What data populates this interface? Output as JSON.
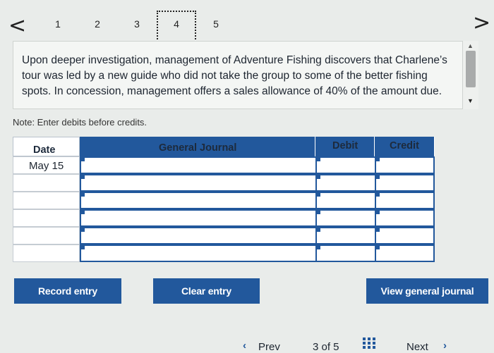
{
  "step_nav": {
    "prev_arrow": "<",
    "next_arrow": ">",
    "steps": [
      "1",
      "2",
      "3",
      "4",
      "5"
    ],
    "current_step": "4"
  },
  "question": {
    "text": "Upon deeper investigation, management of Adventure Fishing discovers that Charlene’s tour was led by a new guide who did not take the group to some of the better fishing spots. In concession, management offers a sales allowance of 40% of the amount due."
  },
  "note": "Note: Enter debits before credits.",
  "journal": {
    "headers": {
      "date": "Date",
      "account": "General Journal",
      "debit": "Debit",
      "credit": "Credit"
    },
    "rows": [
      {
        "date": "May 15",
        "account": "",
        "debit": "",
        "credit": ""
      },
      {
        "date": "",
        "account": "",
        "debit": "",
        "credit": ""
      },
      {
        "date": "",
        "account": "",
        "debit": "",
        "credit": ""
      },
      {
        "date": "",
        "account": "",
        "debit": "",
        "credit": ""
      },
      {
        "date": "",
        "account": "",
        "debit": "",
        "credit": ""
      },
      {
        "date": "",
        "account": "",
        "debit": "",
        "credit": ""
      }
    ]
  },
  "buttons": {
    "record_entry": "Record entry",
    "clear_entry": "Clear entry",
    "view_general_journal": "View general journal"
  },
  "footer": {
    "prev": "Prev",
    "page_indicator": "3 of 5",
    "next": "Next"
  },
  "colors": {
    "accent": "#22589c",
    "background": "#e9ecea"
  }
}
